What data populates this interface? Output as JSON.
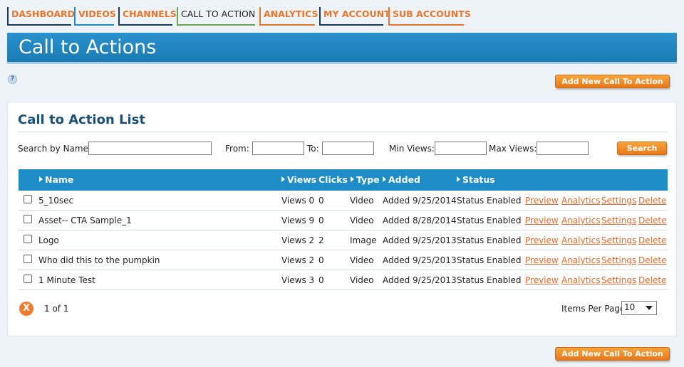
{
  "nav": {
    "tabs": [
      {
        "label": "DASHBOARD",
        "color": "#1a3a5c"
      },
      {
        "label": "VIDEOS",
        "color": "#1d8cc7"
      },
      {
        "label": "CHANNELS",
        "color": "#1a3a5c"
      },
      {
        "label": "CALL TO ACTION",
        "color": "#6aa84f",
        "active": true
      },
      {
        "label": "ANALYTICS",
        "color": "#e8752a"
      },
      {
        "label": "MY ACCOUNT",
        "color": "#1a3a5c"
      },
      {
        "label": "SUB ACCOUNTS",
        "color": "#e8752a"
      }
    ]
  },
  "header": {
    "title": "Call to Actions"
  },
  "help_icon": "?",
  "add_button_label": "Add New Call To Action",
  "panel": {
    "title": "Call to Action List"
  },
  "filters": {
    "name_label": "Search by Name:",
    "from_label": "From:",
    "to_label": "To:",
    "min_views_label": "Min Views:",
    "max_views_label": "Max Views:",
    "search_label": "Search"
  },
  "table": {
    "headers": {
      "name": "Name",
      "views": "Views",
      "clicks": "Clicks",
      "type": "Type",
      "added": "Added",
      "status": "Status"
    },
    "rows": [
      {
        "name": "5_10sec",
        "views": "Views 0",
        "clicks": "0",
        "type": "Video",
        "added": "Added 9/25/2014",
        "status": "Status Enabled"
      },
      {
        "name": "Asset-- CTA Sample_1",
        "views": "Views 9",
        "clicks": "0",
        "type": "Video",
        "added": "Added 8/28/2014",
        "status": "Status Enabled"
      },
      {
        "name": "Logo",
        "views": "Views 2",
        "clicks": "2",
        "type": "Image",
        "added": "Added 9/25/2013",
        "status": "Status Enabled"
      },
      {
        "name": "Who did this to the pumpkin",
        "views": "Views 2",
        "clicks": "0",
        "type": "Video",
        "added": "Added 9/25/2013",
        "status": "Status Enabled"
      },
      {
        "name": "1 Minute Test",
        "views": "Views 3",
        "clicks": "0",
        "type": "Video",
        "added": "Added 9/25/2013",
        "status": "Status Enabled"
      }
    ],
    "actions": {
      "preview": "Preview",
      "analytics": "Analytics",
      "settings": "Settings",
      "delete": "Delete"
    }
  },
  "pagination": {
    "clear_icon": "X",
    "page_info": "1 of 1",
    "items_per_page_label": "Items Per Page",
    "items_per_page_value": "10"
  }
}
